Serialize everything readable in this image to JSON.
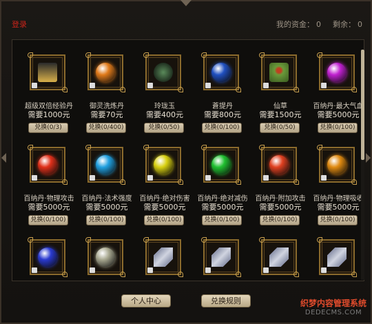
{
  "header": {
    "login": "登录",
    "funds_label": "我的资金：",
    "funds_value": "0",
    "remaining_label": "剩余：",
    "remaining_value": "0"
  },
  "items": [
    {
      "name": "超级双倍经验丹",
      "price": "需要1000元",
      "exchange": "兑换(0/3)",
      "icon": "scroll-pill-icon",
      "color": "#d8b04a"
    },
    {
      "name": "御灵洗炼丹",
      "price": "需要70元",
      "exchange": "兑换(0/400)",
      "icon": "orange-orb-icon",
      "color": "#e07a1a"
    },
    {
      "name": "玲珑玉",
      "price": "需要400元",
      "exchange": "兑换(0/50)",
      "icon": "jade-dragon-icon",
      "color": "#5a8a5a"
    },
    {
      "name": "蒼提丹",
      "price": "需要800元",
      "exchange": "兑换(0/100)",
      "icon": "blue-orb-icon",
      "color": "#2050c0"
    },
    {
      "name": "仙草",
      "price": "需要1500元",
      "exchange": "兑换(0/50)",
      "icon": "herb-icon",
      "color": "#6a9a3a"
    },
    {
      "name": "百纳丹·最大气血",
      "price": "需要5000元",
      "exchange": "兑换(0/100)",
      "icon": "purple-orb-icon",
      "color": "#c020d0"
    },
    {
      "name": "百纳丹·物理攻击",
      "price": "需要5000元",
      "exchange": "兑换(0/100)",
      "icon": "red-orb-icon",
      "color": "#e0301a"
    },
    {
      "name": "百纳丹·法术强度",
      "price": "需要5000元",
      "exchange": "兑换(0/100)",
      "icon": "cyan-orb-icon",
      "color": "#20a0e0"
    },
    {
      "name": "百纳丹·绝对伤害",
      "price": "需要5000元",
      "exchange": "兑换(0/100)",
      "icon": "yellow-orb-icon",
      "color": "#d8d010"
    },
    {
      "name": "百纳丹·绝对减伤",
      "price": "需要5000元",
      "exchange": "兑换(0/100)",
      "icon": "green-orb-icon",
      "color": "#20c030"
    },
    {
      "name": "百纳丹·附加攻击",
      "price": "需要5000元",
      "exchange": "兑换(0/100)",
      "icon": "red-orange-orb-icon",
      "color": "#e04020"
    },
    {
      "name": "百纳丹·物理吸收",
      "price": "需要5000元",
      "exchange": "兑换(0/100)",
      "icon": "amber-orb-icon",
      "color": "#e08a10"
    },
    {
      "name": "",
      "price": "",
      "exchange": "",
      "icon": "dark-blue-orb-icon",
      "color": "#2a3ad0"
    },
    {
      "name": "",
      "price": "",
      "exchange": "",
      "icon": "grey-orb-icon",
      "color": "#a8a890"
    },
    {
      "name": "",
      "price": "",
      "exchange": "",
      "icon": "scroll-icon",
      "color": "#8a90a8"
    },
    {
      "name": "",
      "price": "",
      "exchange": "",
      "icon": "scroll-icon",
      "color": "#8a90a8"
    },
    {
      "name": "",
      "price": "",
      "exchange": "",
      "icon": "scroll-icon",
      "color": "#8a90a8"
    },
    {
      "name": "",
      "price": "",
      "exchange": "",
      "icon": "scroll-icon",
      "color": "#8a90a8"
    }
  ],
  "buttons": {
    "personal_center": "个人中心",
    "exchange_rules": "兑换规则"
  },
  "watermark": {
    "line1": "织梦内容管理系统",
    "line2": "DEDECMS.COM"
  }
}
